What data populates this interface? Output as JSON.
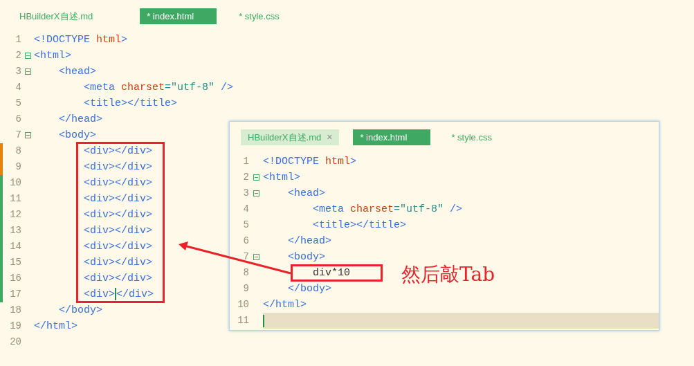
{
  "editor": {
    "tabs": [
      {
        "label": "HBuilderX自述.md",
        "selected": false
      },
      {
        "label": "* index.html",
        "selected": true
      },
      {
        "label": "* style.css",
        "selected": false
      }
    ],
    "lines": [
      {
        "number": "1",
        "fold": false,
        "tokens": [
          {
            "kind": "tag",
            "text": "<!DOCTYPE "
          },
          {
            "kind": "keyword",
            "text": "html"
          },
          {
            "kind": "tag",
            "text": ">"
          }
        ]
      },
      {
        "number": "2",
        "fold": true,
        "tokens": [
          {
            "kind": "tag",
            "text": "<html>"
          }
        ],
        "children": [
          {
            "number": "3",
            "fold": true,
            "tokens": [
              {
                "kind": "tag",
                "text": "<head>"
              }
            ],
            "children": [
              {
                "number": "4",
                "fold": false,
                "tokens": [
                  {
                    "kind": "tag",
                    "text": "<meta "
                  },
                  {
                    "kind": "keyword",
                    "text": "charset"
                  },
                  {
                    "kind": "value",
                    "text": "=\"utf-8\""
                  },
                  {
                    "kind": "tag",
                    "text": " />"
                  }
                ]
              },
              {
                "number": "5",
                "fold": false,
                "tokens": [
                  {
                    "kind": "tag",
                    "text": "<title></title>"
                  }
                ]
              }
            ]
          },
          {
            "number": "6",
            "fold": false,
            "tokens": [
              {
                "kind": "tag",
                "text": "</head>"
              }
            ]
          },
          {
            "number": "7",
            "fold": true,
            "tokens": [
              {
                "kind": "tag",
                "text": "<body>"
              }
            ],
            "children": [
              {
                "number": "8",
                "fold": false,
                "color": "#e8820c",
                "tokens": [
                  {
                    "kind": "tag",
                    "text": "<div></div>"
                  }
                ]
              },
              {
                "number": "9",
                "fold": false,
                "color": "#e8820c",
                "tokens": [
                  {
                    "kind": "tag",
                    "text": "<div></div>"
                  }
                ]
              },
              {
                "number": "10",
                "fold": false,
                "color": "#3fa862",
                "tokens": [
                  {
                    "kind": "tag",
                    "text": "<div></div>"
                  }
                ]
              },
              {
                "number": "11",
                "fold": false,
                "color": "#3fa862",
                "tokens": [
                  {
                    "kind": "tag",
                    "text": "<div></div>"
                  }
                ]
              },
              {
                "number": "12",
                "fold": false,
                "color": "#3fa862",
                "tokens": [
                  {
                    "kind": "tag",
                    "text": "<div></div>"
                  }
                ]
              },
              {
                "number": "13",
                "fold": false,
                "color": "#3fa862",
                "tokens": [
                  {
                    "kind": "tag",
                    "text": "<div></div>"
                  }
                ]
              },
              {
                "number": "14",
                "fold": false,
                "color": "#3fa862",
                "tokens": [
                  {
                    "kind": "tag",
                    "text": "<div></div>"
                  }
                ]
              },
              {
                "number": "15",
                "fold": false,
                "color": "#3fa862",
                "tokens": [
                  {
                    "kind": "tag",
                    "text": "<div></div>"
                  }
                ]
              },
              {
                "number": "16",
                "fold": false,
                "color": "#3fa862",
                "tokens": [
                  {
                    "kind": "tag",
                    "text": "<div></div>"
                  }
                ]
              },
              {
                "number": "17",
                "fold": false,
                "color": "#3fa862",
                "tokens": [
                  {
                    "kind": "tag",
                    "text": "<div>"
                  },
                  {
                    "kind": "cursor"
                  },
                  {
                    "kind": "tag",
                    "text": "</div>"
                  }
                ]
              }
            ]
          },
          {
            "number": "18",
            "fold": false,
            "tokens": [
              {
                "kind": "tag",
                "text": "</body>"
              }
            ]
          }
        ]
      },
      {
        "number": "19",
        "fold": false,
        "tokens": [
          {
            "kind": "tag",
            "text": "</html>"
          }
        ]
      },
      {
        "number": "20",
        "fold": false
      }
    ]
  },
  "inset": {
    "tabs": [
      {
        "label": "HBuilderX自述.md",
        "selected": false,
        "hovered": true,
        "close": "×"
      },
      {
        "label": "* index.html",
        "selected": true,
        "hovered": false
      },
      {
        "label": "* style.css",
        "selected": false,
        "hovered": false
      }
    ],
    "lines": [
      {
        "number": "1",
        "fold": false,
        "current": false,
        "tokens": [
          {
            "kind": "tag",
            "text": "<!DOCTYPE "
          },
          {
            "kind": "keyword",
            "text": "html"
          },
          {
            "kind": "tag",
            "text": ">"
          }
        ]
      },
      {
        "number": "2",
        "fold": true,
        "current": false,
        "tokens": [
          {
            "kind": "tag",
            "text": "<html>"
          }
        ],
        "children": [
          {
            "number": "3",
            "fold": true,
            "current": false,
            "tokens": [
              {
                "kind": "tag",
                "text": "<head>"
              }
            ],
            "children": [
              {
                "number": "4",
                "fold": false,
                "current": false,
                "tokens": [
                  {
                    "kind": "tag",
                    "text": "<meta "
                  },
                  {
                    "kind": "keyword",
                    "text": "charset"
                  },
                  {
                    "kind": "value",
                    "text": "=\"utf-8\""
                  },
                  {
                    "kind": "tag",
                    "text": " />"
                  }
                ]
              },
              {
                "number": "5",
                "fold": false,
                "current": false,
                "tokens": [
                  {
                    "kind": "tag",
                    "text": "<title></title>"
                  }
                ]
              }
            ]
          },
          {
            "number": "6",
            "fold": false,
            "current": false,
            "tokens": [
              {
                "kind": "tag",
                "text": "</head>"
              }
            ]
          },
          {
            "number": "7",
            "fold": true,
            "current": false,
            "tokens": [
              {
                "kind": "tag",
                "text": "<body>"
              }
            ],
            "children": [
              {
                "number": "8",
                "fold": false,
                "current": false,
                "tokens": [
                  {
                    "kind": "text",
                    "text": "div*10"
                  }
                ]
              }
            ]
          },
          {
            "number": "9",
            "fold": false,
            "current": false,
            "tokens": [
              {
                "kind": "tag",
                "text": "</body>"
              }
            ]
          }
        ]
      },
      {
        "number": "10",
        "fold": false,
        "current": false,
        "tokens": [
          {
            "kind": "tag",
            "text": "</html>"
          }
        ]
      },
      {
        "number": "11",
        "fold": false,
        "current": true,
        "tokens": [
          {
            "kind": "cursor"
          }
        ]
      }
    ]
  },
  "annotation": {
    "text": "然后敲Tab"
  }
}
